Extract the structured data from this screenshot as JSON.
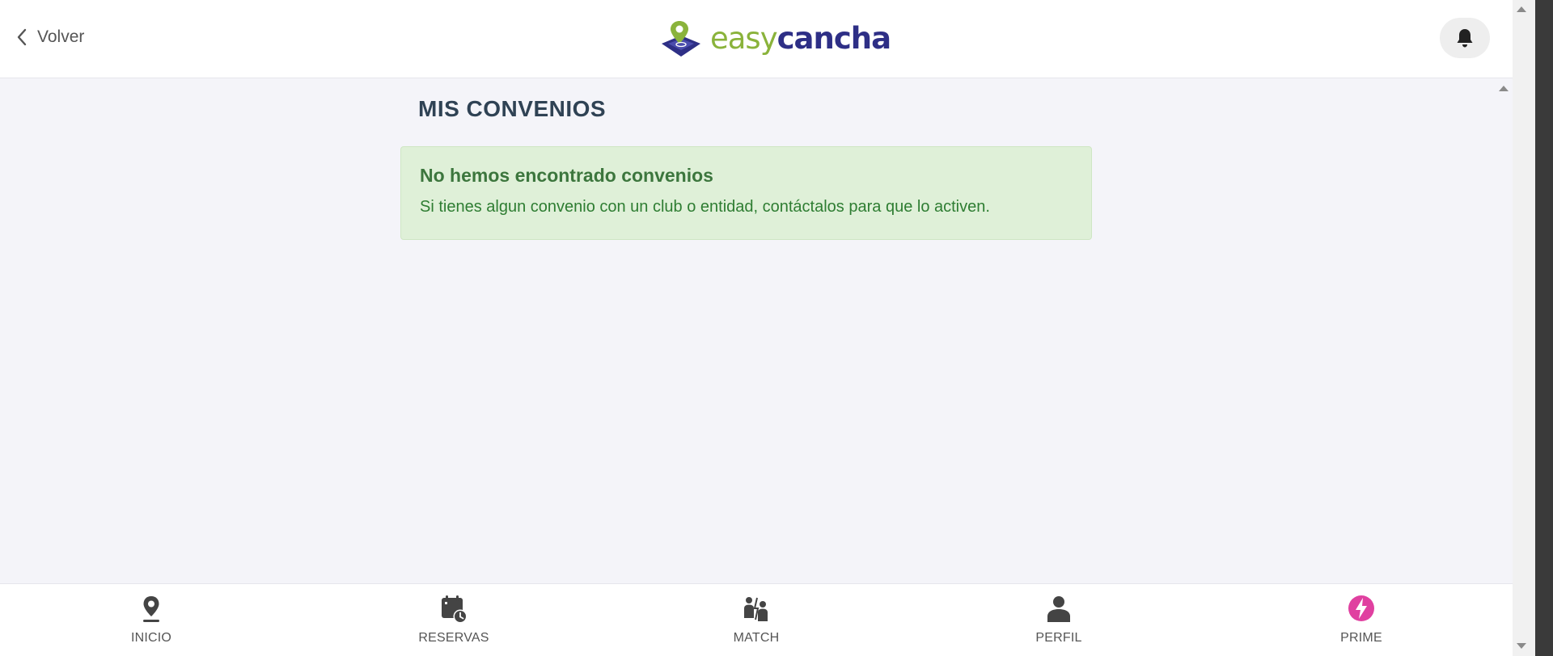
{
  "header": {
    "back_label": "Volver",
    "logo": {
      "part1": "easy",
      "part2": "cancha",
      "color1": "#8ab33b",
      "color2": "#2e2f86"
    },
    "bell_icon": "bell-icon"
  },
  "main": {
    "title": "MIS CONVENIOS",
    "alert": {
      "title": "No hemos encontrado convenios",
      "text": "Si tienes algun convenio con un club o entidad, contáctalos para que lo activen.",
      "bg_color": "#dff0d8",
      "text_color": "#3c763d"
    }
  },
  "bottom_nav": {
    "items": [
      {
        "label": "INICIO",
        "icon": "location-pin-icon"
      },
      {
        "label": "RESERVAS",
        "icon": "calendar-clock-icon"
      },
      {
        "label": "MATCH",
        "icon": "match-players-icon"
      },
      {
        "label": "PERFIL",
        "icon": "user-icon"
      },
      {
        "label": "PRIME",
        "icon": "prime-bolt-icon",
        "accent": "#e040a0"
      }
    ]
  }
}
